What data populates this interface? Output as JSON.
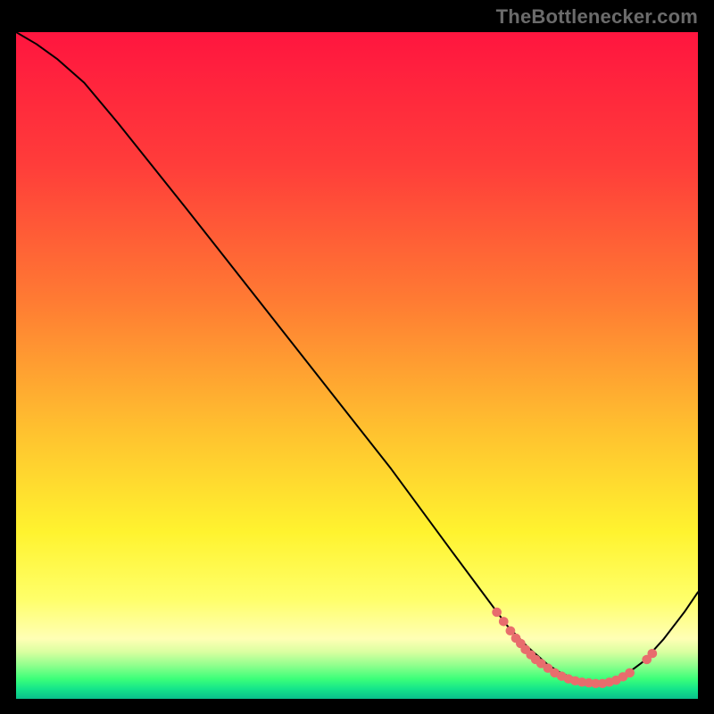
{
  "attribution": "TheBottlenecker.com",
  "gradient_stops": [
    {
      "pct": 0,
      "color": "#ff153f"
    },
    {
      "pct": 20,
      "color": "#ff3d3a"
    },
    {
      "pct": 40,
      "color": "#ff7a33"
    },
    {
      "pct": 60,
      "color": "#ffc22f"
    },
    {
      "pct": 75,
      "color": "#fff32f"
    },
    {
      "pct": 85,
      "color": "#ffff69"
    },
    {
      "pct": 91,
      "color": "#ffffb5"
    },
    {
      "pct": 93,
      "color": "#d9ffa0"
    },
    {
      "pct": 95,
      "color": "#8fff8d"
    },
    {
      "pct": 97,
      "color": "#3cff79"
    },
    {
      "pct": 98.5,
      "color": "#15e58a"
    },
    {
      "pct": 100,
      "color": "#0ac08b"
    }
  ],
  "chart_data": {
    "type": "line",
    "title": "",
    "xlabel": "",
    "ylabel": "",
    "xlim": [
      0,
      100
    ],
    "ylim": [
      0,
      100
    ],
    "curve": [
      {
        "x": 0,
        "y": 100
      },
      {
        "x": 3,
        "y": 98.2
      },
      {
        "x": 6,
        "y": 96.0
      },
      {
        "x": 10,
        "y": 92.4
      },
      {
        "x": 15,
        "y": 86.3
      },
      {
        "x": 25,
        "y": 73.5
      },
      {
        "x": 40,
        "y": 54.0
      },
      {
        "x": 55,
        "y": 34.5
      },
      {
        "x": 64,
        "y": 22.0
      },
      {
        "x": 68,
        "y": 16.5
      },
      {
        "x": 72,
        "y": 11.0
      },
      {
        "x": 75,
        "y": 7.8
      },
      {
        "x": 78,
        "y": 5.1
      },
      {
        "x": 80,
        "y": 3.8
      },
      {
        "x": 83,
        "y": 2.6
      },
      {
        "x": 86,
        "y": 2.3
      },
      {
        "x": 89,
        "y": 3.3
      },
      {
        "x": 92,
        "y": 5.6
      },
      {
        "x": 95,
        "y": 9.0
      },
      {
        "x": 98,
        "y": 13.0
      },
      {
        "x": 100,
        "y": 16.0
      }
    ],
    "markers": [
      {
        "x": 70.5,
        "y": 13.0
      },
      {
        "x": 71.5,
        "y": 11.6
      },
      {
        "x": 72.5,
        "y": 10.2
      },
      {
        "x": 73.3,
        "y": 9.1
      },
      {
        "x": 74.0,
        "y": 8.3
      },
      {
        "x": 74.7,
        "y": 7.4
      },
      {
        "x": 75.5,
        "y": 6.6
      },
      {
        "x": 76.2,
        "y": 5.9
      },
      {
        "x": 77.0,
        "y": 5.3
      },
      {
        "x": 78.0,
        "y": 4.6
      },
      {
        "x": 79.0,
        "y": 3.9
      },
      {
        "x": 80.0,
        "y": 3.4
      },
      {
        "x": 81.0,
        "y": 3.0
      },
      {
        "x": 82.0,
        "y": 2.7
      },
      {
        "x": 83.0,
        "y": 2.5
      },
      {
        "x": 84.0,
        "y": 2.4
      },
      {
        "x": 85.0,
        "y": 2.3
      },
      {
        "x": 86.0,
        "y": 2.3
      },
      {
        "x": 87.0,
        "y": 2.5
      },
      {
        "x": 88.0,
        "y": 2.8
      },
      {
        "x": 89.0,
        "y": 3.3
      },
      {
        "x": 90.0,
        "y": 3.9
      },
      {
        "x": 92.5,
        "y": 5.9
      },
      {
        "x": 93.3,
        "y": 6.8
      }
    ],
    "marker_color": "#e86d6d",
    "curve_color": "#000000"
  }
}
